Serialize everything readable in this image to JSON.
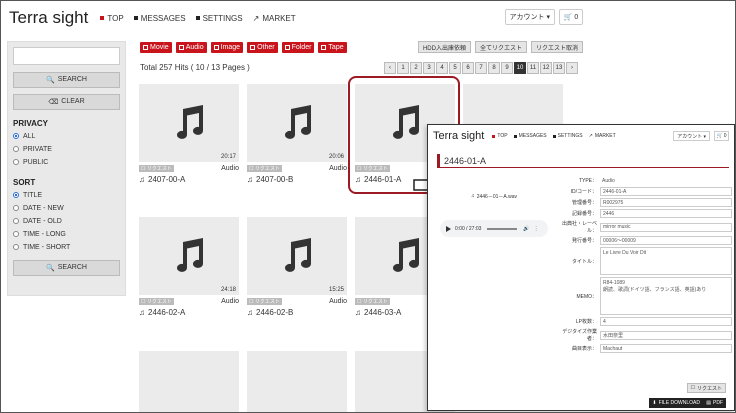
{
  "app": {
    "brand": "Terra sight",
    "nav": [
      {
        "label": "TOP",
        "icon": "red-square-icon"
      },
      {
        "label": "MESSAGES",
        "icon": "black-square-icon"
      },
      {
        "label": "SETTINGS",
        "icon": "black-square-icon"
      },
      {
        "label": "MARKET",
        "icon": "external-link-icon"
      }
    ],
    "account_label": "アカウント ▾",
    "cart_count": "0"
  },
  "sidebar": {
    "search_placeholder": "",
    "search_button": "SEARCH",
    "clear_button": "CLEAR",
    "privacy_heading": "PRIVACY",
    "privacy_options": [
      "ALL",
      "PRIVATE",
      "PUBLIC"
    ],
    "privacy_selected": "ALL",
    "sort_heading": "SORT",
    "sort_options": [
      "TITLE",
      "DATE - NEW",
      "DATE - OLD",
      "TIME - LONG",
      "TIME - SHORT"
    ],
    "sort_selected": "TITLE",
    "search_button_2": "SEARCH"
  },
  "filters": [
    "Movie",
    "Audio",
    "Image",
    "Other",
    "Folder",
    "Tape"
  ],
  "actions": [
    "HDD入出庫依頼",
    "全てリクエスト",
    "リクエスト取消"
  ],
  "results": {
    "total_text": "Total 257 Hits ( 10 / 13 Pages )"
  },
  "pager": {
    "prev": "‹",
    "pages": [
      "1",
      "2",
      "3",
      "4",
      "5",
      "6",
      "7",
      "8",
      "9",
      "10",
      "11",
      "12",
      "13"
    ],
    "current": "10",
    "next": "›"
  },
  "cards": [
    {
      "code": "2407-00-A",
      "duration": "20:17",
      "kind": "Audio",
      "request": "リクエスト"
    },
    {
      "code": "2407-00-B",
      "duration": "20:06",
      "kind": "Audio",
      "request": "リクエスト"
    },
    {
      "code": "2446-01-A",
      "duration": "",
      "kind": "Audio",
      "request": "リクエスト"
    },
    {
      "code": "2446-02-A",
      "duration": "24:18",
      "kind": "Audio",
      "request": "リクエスト"
    },
    {
      "code": "2446-02-B",
      "duration": "15:25",
      "kind": "Audio",
      "request": "リクエスト"
    },
    {
      "code": "2446-03-A",
      "duration": "",
      "kind": "Audio",
      "request": "リクエスト"
    }
  ],
  "detail": {
    "brand": "Terra sight",
    "nav": [
      "TOP",
      "MESSAGES",
      "SETTINGS",
      "MARKET"
    ],
    "account_label": "アカウント ▾",
    "cart_count": "0",
    "title": "2446-01-A",
    "file_name": "2446－01－A.wav",
    "player_time": "0:00 / 27:03",
    "fields": [
      {
        "label": "TYPE：",
        "value": "Audio",
        "plain": true
      },
      {
        "label": "ID/コード：",
        "value": "2446-01-A"
      },
      {
        "label": "管理番号：",
        "value": "R002975"
      },
      {
        "label": "記録番号：",
        "value": "2446"
      },
      {
        "label": "出典社・レーベル：",
        "value": "mirror music"
      },
      {
        "label": "発行番号：",
        "value": "00006～00009"
      },
      {
        "label": "タイトル：",
        "value": "Le Livre Du Voir Dit",
        "tall": 28
      },
      {
        "label": "MEMO：",
        "value": "R84-1089\n朗読、歌詞(ドイツ語、フランス語、英語)あり",
        "tall": 36
      },
      {
        "label": "LP枚数：",
        "value": "4"
      },
      {
        "label": "デジタイズ作業者：",
        "value": "水田奈里"
      },
      {
        "label": "曲目表示：",
        "value": "Machaut"
      }
    ],
    "request_button": "リクエスト",
    "download_button": "FILE DOWNLOAD",
    "pdf_button": "PDF"
  },
  "colors": {
    "accent": "#c9141c",
    "highlight": "#9b1a24"
  }
}
